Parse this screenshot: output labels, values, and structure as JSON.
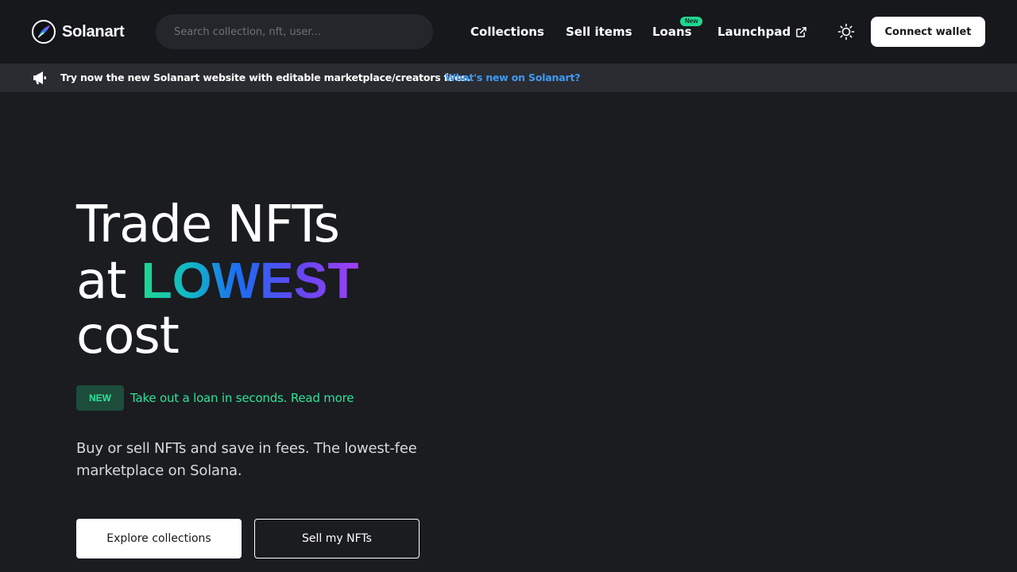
{
  "header": {
    "brand": "Solanart",
    "search_placeholder": "Search collection, nft, user...",
    "nav": {
      "collections": "Collections",
      "sell_items": "Sell items",
      "loans": "Loans",
      "loans_badge": "New",
      "launchpad": "Launchpad"
    },
    "theme_icon": "sun-icon",
    "connect_wallet": "Connect wallet"
  },
  "announcement": {
    "icon": "megaphone-icon",
    "text": "Try now the new Solanart website with editable marketplace/creators fees.",
    "link": "What's new on Solanart?"
  },
  "hero": {
    "title_line1": "Trade NFTs",
    "title_line2_prefix": "at",
    "title_highlight": "LOWEST",
    "title_line3": "cost",
    "new_badge": "NEW",
    "loan_link": "Take out a loan in seconds. Read more",
    "description": "Buy or sell NFTs and save in fees. The lowest-fee marketplace on Solana.",
    "explore_button": "Explore collections",
    "sell_button": "Sell my NFTs"
  },
  "colors": {
    "background": "#1a1c20",
    "header_bg": "#16181c",
    "announcement_bg": "#2a2c31",
    "link_blue": "#3f9bf5",
    "accent_green": "#2de39a",
    "gradient": [
      "#1fd88e",
      "#11b7c7",
      "#1d6cf0",
      "#5d48f0",
      "#a13ef5"
    ]
  }
}
